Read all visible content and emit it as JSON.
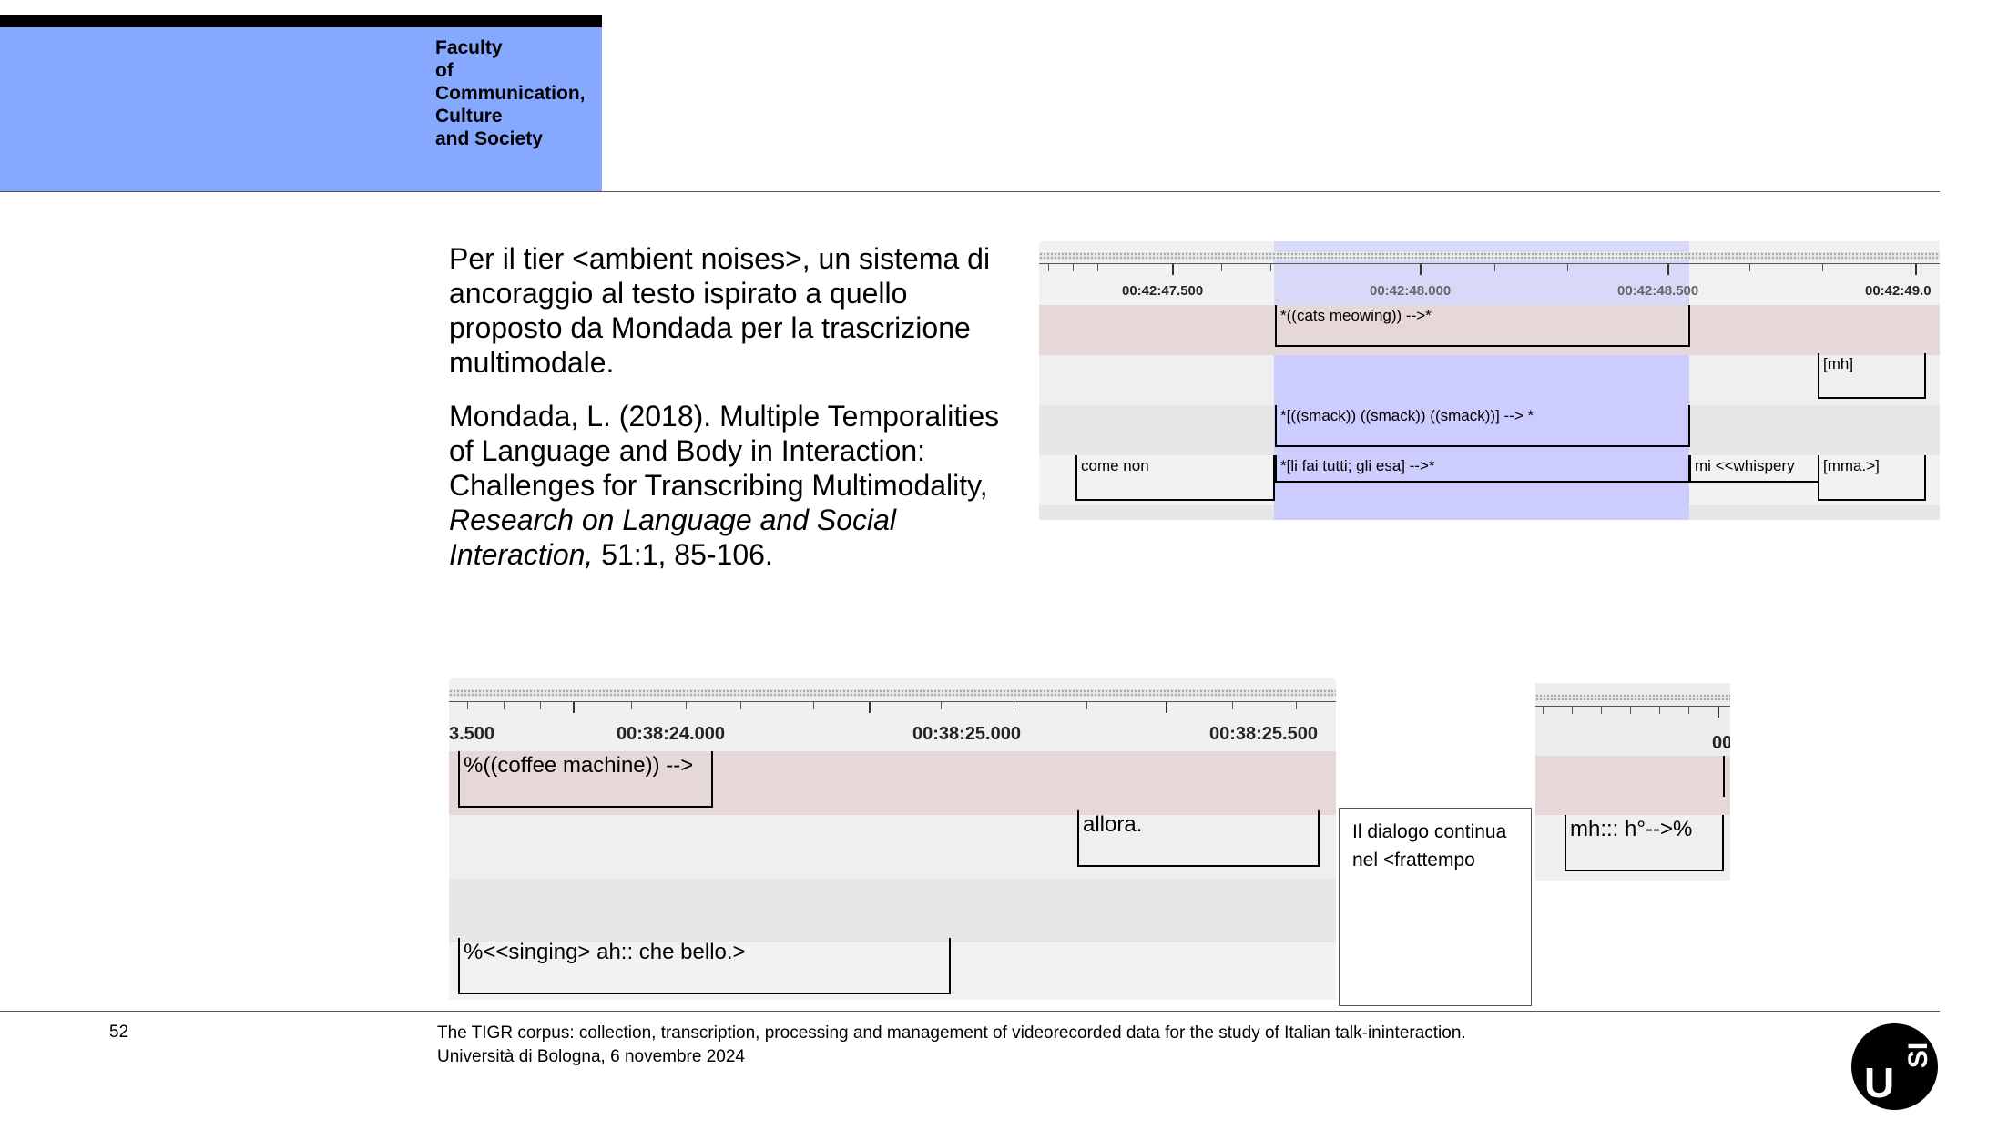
{
  "header": {
    "faculty_label": "Faculty\nof\nCommunication,\nCulture\nand Society"
  },
  "text": {
    "paragraph1": "Per il tier <ambient noises>, un sistema di ancoraggio al testo ispirato a quello proposto da Mondada per la trascrizione multimodale.",
    "ref_part1": "Mondada, L. (2018). Multiple Temporalities of Language and Body in Interaction: Challenges for Transcribing Multimodality, ",
    "ref_italic": "Research on Language and Social Interaction,",
    "ref_part2": " 51:1, 85-106."
  },
  "panel_top": {
    "time_labels": [
      "00:42:47.500",
      "00:42:48.000",
      "00:42:48.500",
      "00:42:49.0"
    ],
    "annotations": {
      "cats": "*((cats meowing)) -->*",
      "mh": "[mh]",
      "smack": "*[((smack)) ((smack)) ((smack))] --> *",
      "come_non": "come non",
      "li_fai": "*[li fai tutti; gli esa] -->*",
      "mi_whispery": "mi <<whispery",
      "mma": "[mma.>]"
    }
  },
  "panel_bottom_left": {
    "time_labels": [
      "3.500",
      "00:38:24.000",
      "00:38:25.000",
      "00:38:25.500"
    ],
    "annotations": {
      "coffee": "%((coffee machine)) -->",
      "allora": "allora.",
      "singing": "%<<singing> ah:: che bello.>"
    }
  },
  "note": {
    "text": "Il dialogo continua nel <frattempo"
  },
  "panel_bottom_right": {
    "time_label": "00",
    "annotations": {
      "mh_h": "mh::: h°-->%"
    }
  },
  "footer": {
    "page_number": "52",
    "line1": "The TIGR corpus: collection, transcription, processing and management of videorecorded data for the study of Italian talk-ininteraction.",
    "line2": "Università di Bologna, 6 novembre 2024"
  },
  "logo": {
    "u": "U",
    "si": "SI"
  },
  "colors": {
    "faculty_blue": "#86a8ff",
    "tier_pink": "#e6d8d8",
    "tier_grey": "#efefef",
    "selection": "#ccccff"
  }
}
